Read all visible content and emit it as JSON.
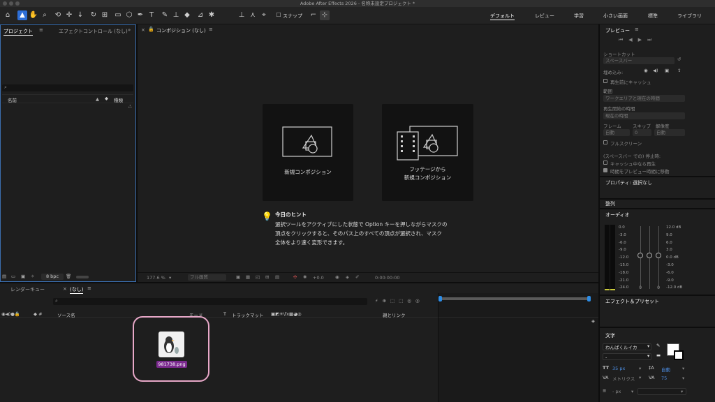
{
  "app": {
    "title": "Adobe After Effects 2026 - 名称未設定プロジェクト *"
  },
  "toolbar": {
    "snap_label": "スナップ"
  },
  "workspaces": [
    "デフォルト",
    "レビュー",
    "学習",
    "小さい画面",
    "標準",
    "ライブラリ"
  ],
  "project_panel": {
    "tab_project": "プロジェクト",
    "tab_effects": "エフェクトコントロール (なし)",
    "search_placeholder": "",
    "col_name": "名前",
    "col_type": "種類",
    "bpc": "8 bpc"
  },
  "comp_panel": {
    "tab": "コンポジション (なし)",
    "new_comp_label": "新規コンポジション",
    "footage_comp_line1": "フッテージから",
    "footage_comp_line2": "新規コンポジション",
    "hint_title": "今日のヒント",
    "hint_line1": "選択ツールをアクティブにした状態で Option キーを押しながらマスクの",
    "hint_line2": "頂点をクリックすると、そのパス上のすべての頂点が選択され、マスク",
    "hint_line3": "全体をより速く変形できます。",
    "zoom": "177.6 %",
    "quality": "フル画質",
    "exposure": "+0.0",
    "timecode": "0:00:00:00"
  },
  "preview_panel": {
    "title": "プレビュー",
    "shortcut_label": "ショートカット",
    "shortcut_value": "スペースバー",
    "include_label": "埋め込み:",
    "cache_label": "再生前にキャッシュ",
    "range_label": "範囲",
    "range_value": "ワークエリアと現在の時間",
    "start_label": "再生開始の時間",
    "start_value": "現在の時間",
    "frame_label": "フレーム",
    "skip_label": "スキップ",
    "res_label": "解像度",
    "frame_value": "自動",
    "skip_value": "0",
    "res_value": "自動",
    "fullscreen_label": "フルスクリーン",
    "stop_label": "(スペースバー での) 停止時:",
    "stop_opt1": "キャッシュ中なら再生",
    "stop_opt2": "時間をプレビュー時間に移動"
  },
  "properties_panel": {
    "title": "プロパティ: 選択なし"
  },
  "align_panel": {
    "title": "整列"
  },
  "audio_panel": {
    "title": "オーディオ",
    "left_scale": [
      "0.0",
      "-3.0",
      "-6.0",
      "-9.0",
      "-12.0",
      "-15.0",
      "-18.0",
      "-21.0",
      "-24.0"
    ],
    "right_scale": [
      "12.0 dB",
      "9.0",
      "6.0",
      "3.0",
      "0.0 dB",
      "-3.0",
      "-6.0",
      "-9.0",
      "-12.0 dB"
    ],
    "fader_left": "0",
    "fader_right": "0"
  },
  "effects_panel": {
    "title": "エフェクト＆プリセット"
  },
  "character_panel": {
    "title": "文字",
    "font": "わんぱくルイカ",
    "style": "-",
    "font_size": "35 px",
    "leading": "自動",
    "kerning": "メトリクス",
    "tracking": "75",
    "stroke": "- px"
  },
  "timeline": {
    "tab_render": "レンダーキュー",
    "tab_comp": "(なし)",
    "col_source": "ソース名",
    "col_mode": "モード",
    "col_t": "T",
    "col_trackmatte": "トラックマット",
    "col_parent": "親とリンク",
    "drag_file": "981738.png"
  },
  "colors": {
    "accent": "#2d6ed6",
    "highlight_ring": "#e8a8c8",
    "file_label_bg": "#7b2a8e"
  }
}
